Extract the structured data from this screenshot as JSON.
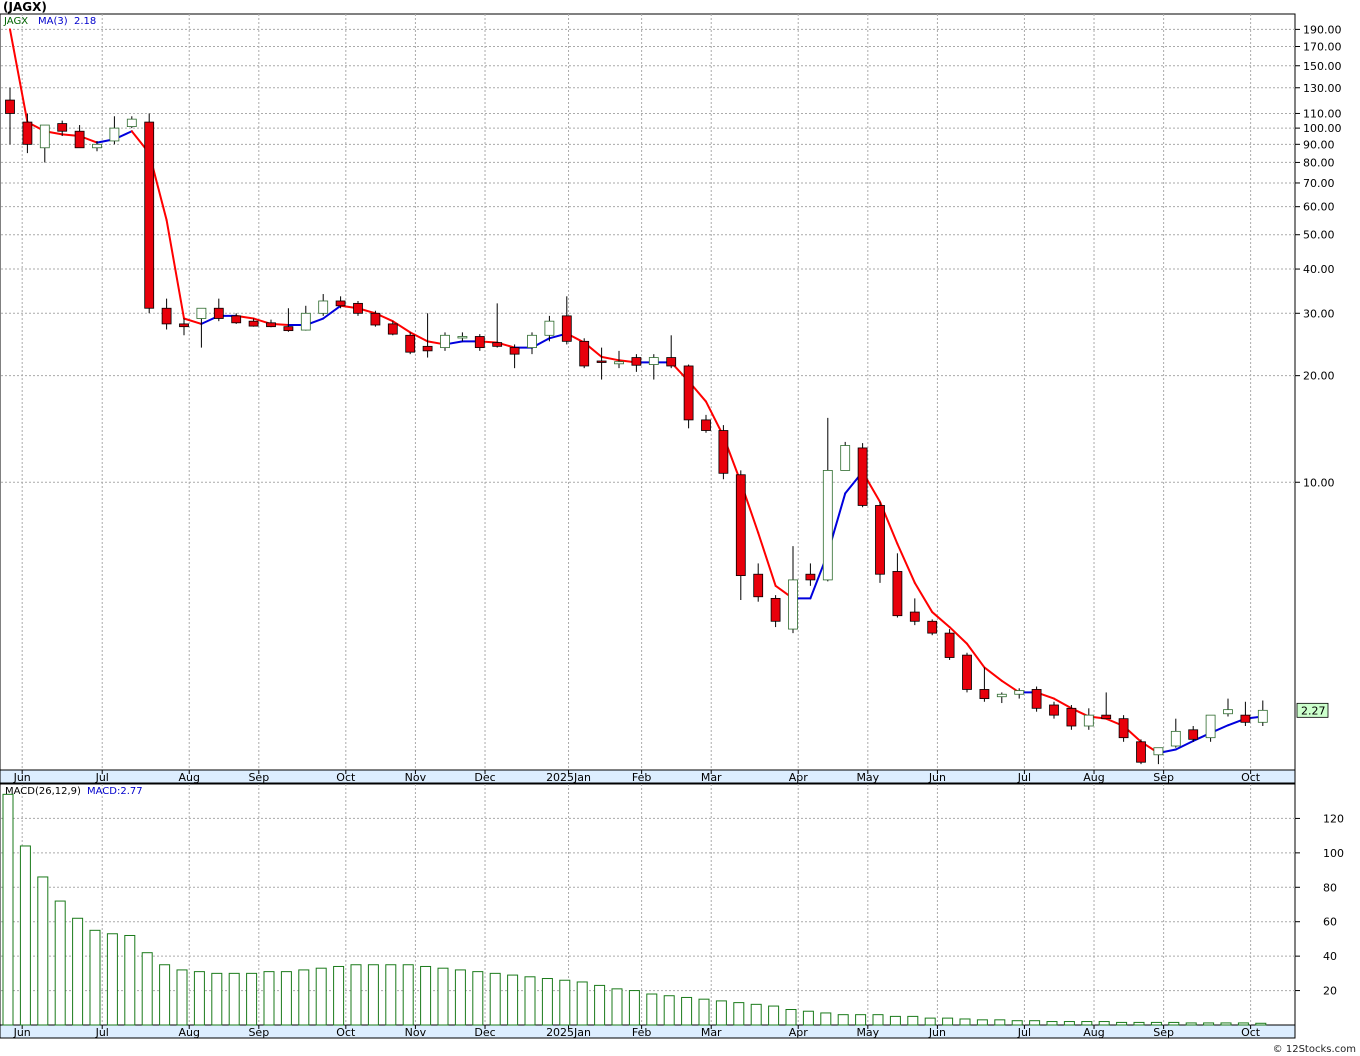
{
  "header": {
    "title": "(JAGX)"
  },
  "legend": {
    "symbol": "JAGX",
    "ma_label": "MA(3)",
    "ma_value": "2.18",
    "macd_label": "MACD(26,12,9)",
    "macd_value": "MACD:2.77"
  },
  "footer": {
    "credit": "© 12Stocks.com"
  },
  "colors": {
    "up_body": "#ffffff",
    "up_outline": "#2e6b2e",
    "down_body": "#e8000b",
    "ma_down": "#ff0000",
    "ma_up": "#0000dd",
    "grid": "#aaaaaa",
    "price_tag_bg": "#ccffcc",
    "macd_bar": "#1a7a1a"
  },
  "chart_data": [
    {
      "type": "candlestick",
      "scale": "log",
      "ylim": [
        1.54,
        210
      ],
      "price_tag": "2.27",
      "yticks": [
        "190.00",
        "170.00",
        "150.00",
        "130.00",
        "110.00",
        "100.00",
        "90.00",
        "80.00",
        "70.00",
        "60.00",
        "50.00",
        "40.00",
        "30.00",
        "20.00",
        "10.00"
      ],
      "xticks": [
        {
          "label": "Jun",
          "w": 0.7
        },
        {
          "label": "Jul",
          "w": 5.3
        },
        {
          "label": "Aug",
          "w": 10.3
        },
        {
          "label": "Sep",
          "w": 14.3
        },
        {
          "label": "Oct",
          "w": 19.3
        },
        {
          "label": "Nov",
          "w": 23.3
        },
        {
          "label": "Dec",
          "w": 27.3
        },
        {
          "label": "2025Jan",
          "w": 32.1
        },
        {
          "label": "Feb",
          "w": 36.3
        },
        {
          "label": "Mar",
          "w": 40.3
        },
        {
          "label": "Apr",
          "w": 45.3
        },
        {
          "label": "May",
          "w": 49.3
        },
        {
          "label": "Jun",
          "w": 53.3
        },
        {
          "label": "Jul",
          "w": 58.3
        },
        {
          "label": "Aug",
          "w": 62.3
        },
        {
          "label": "Sep",
          "w": 66.3
        },
        {
          "label": "Oct",
          "w": 71.3
        }
      ],
      "candles": [
        {
          "o": 120,
          "h": 130,
          "l": 90,
          "c": 110
        },
        {
          "o": 104,
          "h": 110,
          "l": 85,
          "c": 90
        },
        {
          "o": 88,
          "h": 102,
          "l": 80,
          "c": 102
        },
        {
          "o": 103,
          "h": 105,
          "l": 95,
          "c": 98
        },
        {
          "o": 98,
          "h": 102,
          "l": 88,
          "c": 88
        },
        {
          "o": 88,
          "h": 92,
          "l": 86,
          "c": 90
        },
        {
          "o": 92,
          "h": 108,
          "l": 90,
          "c": 100
        },
        {
          "o": 101,
          "h": 108,
          "l": 100,
          "c": 106
        },
        {
          "o": 104,
          "h": 110,
          "l": 30,
          "c": 31
        },
        {
          "o": 31,
          "h": 33,
          "l": 27,
          "c": 28
        },
        {
          "o": 28,
          "h": 29,
          "l": 26,
          "c": 27.5
        },
        {
          "o": 29,
          "h": 31,
          "l": 24,
          "c": 31
        },
        {
          "o": 31,
          "h": 33,
          "l": 28.5,
          "c": 29
        },
        {
          "o": 29.5,
          "h": 30,
          "l": 28,
          "c": 28.2
        },
        {
          "o": 28.5,
          "h": 29,
          "l": 27.5,
          "c": 27.6
        },
        {
          "o": 28.2,
          "h": 28.8,
          "l": 27.4,
          "c": 27.5
        },
        {
          "o": 27.5,
          "h": 31,
          "l": 26.6,
          "c": 26.8
        },
        {
          "o": 26.9,
          "h": 31.5,
          "l": 26.8,
          "c": 30
        },
        {
          "o": 30,
          "h": 34,
          "l": 29.5,
          "c": 32.5
        },
        {
          "o": 32.5,
          "h": 33.5,
          "l": 31,
          "c": 31.5
        },
        {
          "o": 32,
          "h": 32.5,
          "l": 29.5,
          "c": 30
        },
        {
          "o": 30,
          "h": 30.5,
          "l": 27.5,
          "c": 27.8
        },
        {
          "o": 28,
          "h": 28.5,
          "l": 26,
          "c": 26.2
        },
        {
          "o": 26,
          "h": 26.5,
          "l": 23,
          "c": 23.3
        },
        {
          "o": 24.2,
          "h": 30,
          "l": 22.5,
          "c": 23.5
        },
        {
          "o": 24,
          "h": 26.5,
          "l": 23.5,
          "c": 26
        },
        {
          "o": 25.8,
          "h": 26.5,
          "l": 25,
          "c": 25.8
        },
        {
          "o": 25.8,
          "h": 26.2,
          "l": 23.5,
          "c": 24
        },
        {
          "o": 24.8,
          "h": 32,
          "l": 24,
          "c": 24.2
        },
        {
          "o": 24,
          "h": 24.5,
          "l": 21,
          "c": 23
        },
        {
          "o": 24,
          "h": 26.5,
          "l": 23,
          "c": 26
        },
        {
          "o": 26,
          "h": 29.5,
          "l": 25,
          "c": 28.5
        },
        {
          "o": 29.5,
          "h": 33.5,
          "l": 24.5,
          "c": 25
        },
        {
          "o": 25,
          "h": 25.5,
          "l": 21,
          "c": 21.3
        },
        {
          "o": 22,
          "h": 24,
          "l": 19.5,
          "c": 21.8
        },
        {
          "o": 21.6,
          "h": 23.5,
          "l": 21,
          "c": 21.9
        },
        {
          "o": 22.5,
          "h": 23,
          "l": 20.5,
          "c": 21.4
        },
        {
          "o": 21.5,
          "h": 23,
          "l": 19.5,
          "c": 22.5
        },
        {
          "o": 22.5,
          "h": 26,
          "l": 21,
          "c": 21.3
        },
        {
          "o": 21.3,
          "h": 21.5,
          "l": 14.2,
          "c": 15
        },
        {
          "o": 15,
          "h": 15.5,
          "l": 13.8,
          "c": 14
        },
        {
          "o": 14,
          "h": 14.5,
          "l": 10.2,
          "c": 10.6
        },
        {
          "o": 10.5,
          "h": 10.8,
          "l": 4.65,
          "c": 5.45
        },
        {
          "o": 5.5,
          "h": 5.9,
          "l": 4.6,
          "c": 4.75
        },
        {
          "o": 4.7,
          "h": 4.8,
          "l": 3.9,
          "c": 4.05
        },
        {
          "o": 3.85,
          "h": 6.6,
          "l": 3.75,
          "c": 5.3
        },
        {
          "o": 5.5,
          "h": 5.9,
          "l": 5.1,
          "c": 5.3
        },
        {
          "o": 5.3,
          "h": 15.2,
          "l": 5.25,
          "c": 10.8
        },
        {
          "o": 10.8,
          "h": 13,
          "l": 10.8,
          "c": 12.7
        },
        {
          "o": 12.5,
          "h": 12.9,
          "l": 8.5,
          "c": 8.6
        },
        {
          "o": 8.6,
          "h": 8.8,
          "l": 5.2,
          "c": 5.5
        },
        {
          "o": 5.6,
          "h": 6.3,
          "l": 4.15,
          "c": 4.2
        },
        {
          "o": 4.3,
          "h": 4.7,
          "l": 3.95,
          "c": 4.05
        },
        {
          "o": 4.05,
          "h": 4.1,
          "l": 3.7,
          "c": 3.75
        },
        {
          "o": 3.75,
          "h": 3.85,
          "l": 3.15,
          "c": 3.2
        },
        {
          "o": 3.25,
          "h": 3.3,
          "l": 2.55,
          "c": 2.6
        },
        {
          "o": 2.6,
          "h": 3.0,
          "l": 2.4,
          "c": 2.45
        },
        {
          "o": 2.48,
          "h": 2.55,
          "l": 2.38,
          "c": 2.52
        },
        {
          "o": 2.52,
          "h": 2.62,
          "l": 2.45,
          "c": 2.58
        },
        {
          "o": 2.6,
          "h": 2.65,
          "l": 2.25,
          "c": 2.3
        },
        {
          "o": 2.35,
          "h": 2.4,
          "l": 2.15,
          "c": 2.2
        },
        {
          "o": 2.3,
          "h": 2.35,
          "l": 2.0,
          "c": 2.05
        },
        {
          "o": 2.05,
          "h": 2.3,
          "l": 2.0,
          "c": 2.2
        },
        {
          "o": 2.2,
          "h": 2.55,
          "l": 2.15,
          "c": 2.15
        },
        {
          "o": 2.15,
          "h": 2.2,
          "l": 1.85,
          "c": 1.9
        },
        {
          "o": 1.85,
          "h": 1.88,
          "l": 1.6,
          "c": 1.62
        },
        {
          "o": 1.7,
          "h": 1.78,
          "l": 1.6,
          "c": 1.78
        },
        {
          "o": 1.8,
          "h": 2.15,
          "l": 1.78,
          "c": 1.98
        },
        {
          "o": 2.0,
          "h": 2.05,
          "l": 1.85,
          "c": 1.88
        },
        {
          "o": 1.9,
          "h": 2.2,
          "l": 1.85,
          "c": 2.2
        },
        {
          "o": 2.22,
          "h": 2.45,
          "l": 2.18,
          "c": 2.28
        },
        {
          "o": 2.2,
          "h": 2.4,
          "l": 2.05,
          "c": 2.1
        },
        {
          "o": 2.1,
          "h": 2.42,
          "l": 2.05,
          "c": 2.27
        }
      ],
      "ma3": [
        190,
        104,
        98,
        96,
        95,
        91,
        93,
        98,
        85,
        55,
        29,
        28,
        29.5,
        29.5,
        29,
        28,
        27.8,
        27.8,
        29,
        31.5,
        31,
        30,
        28.5,
        26.5,
        25,
        24.5,
        25,
        25,
        24.8,
        24,
        24,
        25.5,
        26.3,
        24.8,
        22.6,
        22.1,
        21.8,
        21.8,
        21.8,
        19.3,
        16.9,
        13.5,
        10,
        7.2,
        5.1,
        4.7,
        4.7,
        6.3,
        9.3,
        10.7,
        8.8,
        6.7,
        5.2,
        4.3,
        3.9,
        3.5,
        3.0,
        2.75,
        2.55,
        2.55,
        2.45,
        2.3,
        2.18,
        2.15,
        2.05,
        1.85,
        1.72,
        1.76,
        1.86,
        1.96,
        2.06,
        2.15,
        2.18
      ]
    },
    {
      "type": "bar",
      "name": "MACD(26,12,9)",
      "ylim": [
        0,
        140
      ],
      "yticks": [
        "120",
        "100",
        "80",
        "60",
        "40",
        "20"
      ],
      "xticks": [
        "Jun",
        "Jul",
        "Aug",
        "Sep",
        "Oct",
        "Nov",
        "Dec",
        "2025Jan",
        "Feb",
        "Mar",
        "Apr",
        "May",
        "Jun",
        "Jul",
        "Aug",
        "Sep",
        "Oct"
      ],
      "values": [
        134,
        104,
        86,
        72,
        62,
        55,
        53,
        52,
        42,
        35,
        32,
        31,
        30,
        30,
        30,
        31,
        31,
        32,
        33,
        34,
        35,
        35,
        35,
        35,
        34,
        33,
        32,
        31,
        30,
        29,
        28,
        27,
        26,
        25,
        23,
        21,
        20,
        18,
        17,
        16,
        15,
        14,
        13,
        12,
        11,
        9,
        8,
        7,
        6,
        6,
        6,
        5,
        5,
        4,
        4,
        3.5,
        3,
        3,
        2.5,
        2.5,
        2,
        2,
        2,
        2,
        1.5,
        1.5,
        1.5,
        1.5,
        1.2,
        1.2,
        1.2,
        1.2,
        1.0
      ]
    }
  ]
}
